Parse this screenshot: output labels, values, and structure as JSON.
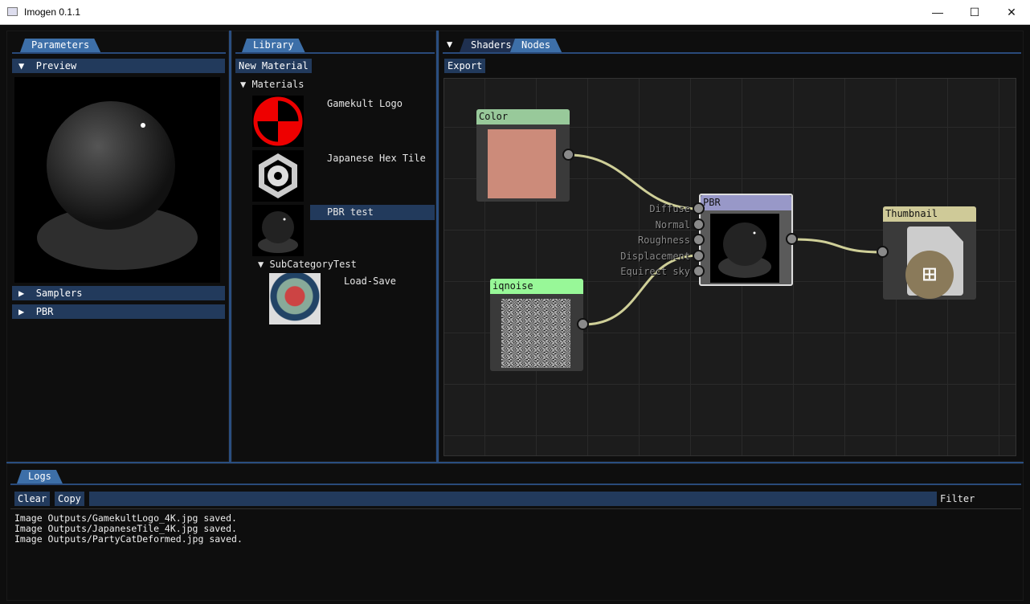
{
  "window": {
    "title": "Imogen 0.1.1",
    "minimize": "—",
    "maximize": "☐",
    "close": "✕"
  },
  "parameters": {
    "tab": "Parameters",
    "sections": [
      {
        "label": "Preview",
        "expanded": true
      },
      {
        "label": "Samplers",
        "expanded": false
      },
      {
        "label": "PBR",
        "expanded": false
      }
    ]
  },
  "library": {
    "tab": "Library",
    "new_material": "New Material",
    "category": "Materials",
    "items": [
      "Gamekult Logo",
      "Japanese Hex Tile",
      "PBR test"
    ],
    "selected": "PBR test",
    "subcategory": "SubCategoryTest",
    "sub_items": [
      "Load-Save"
    ]
  },
  "nodes_panel": {
    "tabs": [
      "Shaders",
      "Nodes"
    ],
    "active_tab": "Nodes",
    "export": "Export",
    "nodes": {
      "color": {
        "title": "Color",
        "header": "#98c99a",
        "swatch": "#cc8b7a"
      },
      "pbr": {
        "title": "PBR",
        "header": "#9898c8",
        "inputs": [
          "Diffuse",
          "Normal",
          "Roughness",
          "Displacement",
          "Equirect sky"
        ]
      },
      "thumbnail": {
        "title": "Thumbnail",
        "header": "#cfca98"
      },
      "iqnoise": {
        "title": "iqnoise",
        "header": "#98f898"
      }
    },
    "link_color": "#cfcf98"
  },
  "logs": {
    "tab": "Logs",
    "clear": "Clear",
    "copy": "Copy",
    "filter_label": "Filter",
    "filter_value": "",
    "lines": [
      "Image Outputs/GamekultLogo_4K.jpg saved.",
      "Image Outputs/JapaneseTile_4K.jpg saved.",
      "Image Outputs/PartyCatDeformed.jpg saved."
    ]
  }
}
